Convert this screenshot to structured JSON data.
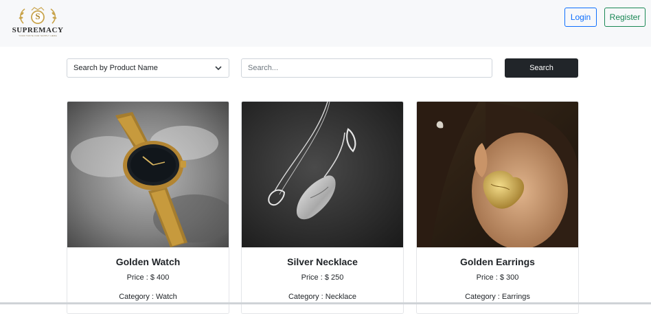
{
  "brand": {
    "name": "SUPREMACY",
    "tagline": "YOUR TASTE OUR SUPPLY HERE",
    "monogram": "S"
  },
  "nav": {
    "login_label": "Login",
    "register_label": "Register"
  },
  "filters": {
    "select_value": "Search by Product Name",
    "search_placeholder": "Search...",
    "search_button": "Search"
  },
  "products": [
    {
      "title": "Golden Watch",
      "price": "Price : $ 400",
      "category": "Category : Watch",
      "image_icon": "watch-image"
    },
    {
      "title": "Silver Necklace",
      "price": "Price : $ 250",
      "category": "Category : Necklace",
      "image_icon": "necklace-image"
    },
    {
      "title": "Golden Earrings",
      "price": "Price : $ 300",
      "category": "Category : Earrings",
      "image_icon": "earrings-image"
    }
  ],
  "colors": {
    "primary": "#0d6efd",
    "success": "#198754",
    "dark": "#212529",
    "gold": "#c9a44c"
  }
}
